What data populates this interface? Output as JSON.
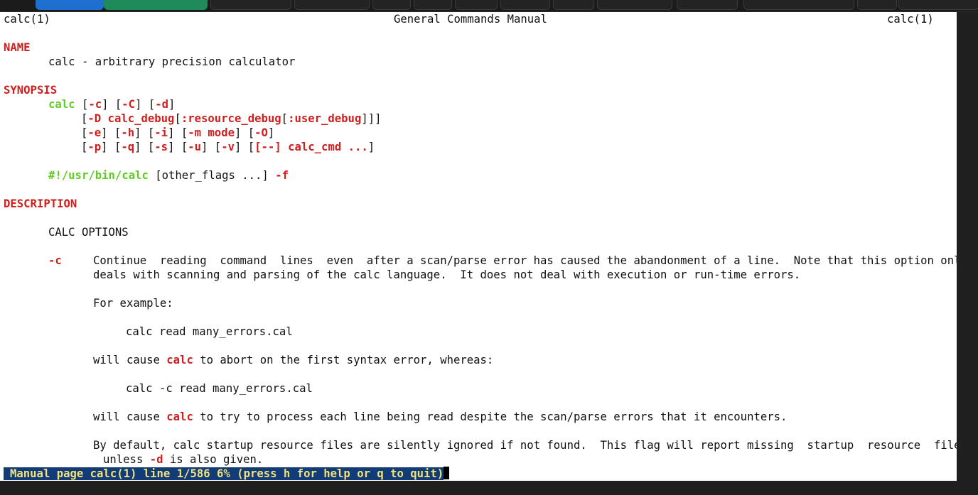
{
  "header": {
    "left": "calc(1)",
    "center": "General Commands Manual",
    "right": "calc(1)"
  },
  "name": {
    "heading": "NAME",
    "text": "calc - arbitrary precision calculator"
  },
  "synopsis": {
    "heading": "SYNOPSIS",
    "cmd": "calc",
    "line1_rest": [
      " [",
      "-c",
      "] [",
      "-C",
      "] [",
      "-d",
      "]"
    ],
    "line2": [
      "[",
      "-D calc_debug",
      "[",
      ":resource_debug",
      "[",
      ":user_debug",
      "]]]"
    ],
    "line3": [
      "[",
      "-e",
      "] [",
      "-h",
      "] [",
      "-i",
      "] [",
      "-m mode",
      "] [",
      "-O",
      "]"
    ],
    "line4": [
      "[",
      "-p",
      "] [",
      "-q",
      "] [",
      "-s",
      "] [",
      "-u",
      "] [",
      "-v",
      "] [",
      "[--]",
      " ",
      "calc_cmd ...",
      "]"
    ],
    "shebang": "#!/usr/bin/calc",
    "shebang_rest": " [other_flags ...] ",
    "shebang_flag": "-f"
  },
  "description": {
    "heading": "DESCRIPTION",
    "subheading": "CALC OPTIONS",
    "opt_c": "-c",
    "para1_l1": "Continue  reading  command  lines  even  after a scan/parse error has caused the abandonment of a line.  Note that this option only",
    "para1_l2": "deals with scanning and parsing of the calc language.  It does not deal with execution or run-time errors.",
    "for_example": "For example:",
    "ex1": "calc read many_errors.cal",
    "will1_a": "will cause ",
    "will_calc": "calc",
    "will1_b": " to abort on the first syntax error, whereas:",
    "ex2": "calc -c read many_errors.cal",
    "will2_a": "will cause ",
    "will2_b": " to try to process each line being read despite the scan/parse errors that it encounters.",
    "para2_l1": "By default, calc startup resource files are silently ignored if not found.  This flag will report missing  startup  resource  files",
    "para2_l2_a": "unless ",
    "para2_l2_flag": "-d",
    "para2_l2_b": " is also given."
  },
  "status_bar": {
    "text": "Manual page calc(1) line 1/586 6% (press h for help or q to quit)"
  }
}
